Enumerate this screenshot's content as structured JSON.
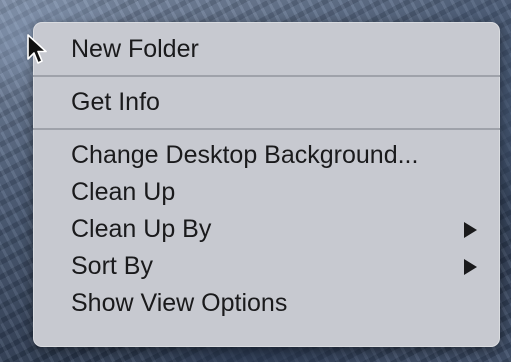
{
  "context_menu": {
    "items": [
      {
        "label": "New Folder",
        "has_submenu": false
      },
      {
        "label": "Get Info",
        "has_submenu": false
      },
      {
        "label": "Change Desktop Background...",
        "has_submenu": false
      },
      {
        "label": "Clean Up",
        "has_submenu": false
      },
      {
        "label": "Clean Up By",
        "has_submenu": true
      },
      {
        "label": "Sort By",
        "has_submenu": true
      },
      {
        "label": "Show View Options",
        "has_submenu": false
      }
    ]
  },
  "icons": {
    "cursor": "mouse-pointer-icon",
    "submenu_arrow": "submenu-arrow-icon"
  },
  "colors": {
    "menu_background": "#c7c9d0",
    "menu_text": "#1a1a1c",
    "separator": "#9fa2aa"
  }
}
